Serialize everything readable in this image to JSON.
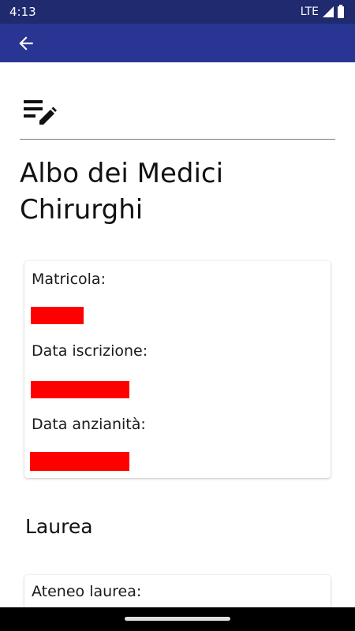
{
  "status_bar": {
    "time": "4:13",
    "network": "LTE"
  },
  "app_bar": {
    "back_icon": "arrow-left-icon",
    "color": "#283593"
  },
  "header": {
    "icon": "edit-list-icon",
    "title": "Albo dei Medici Chirurghi"
  },
  "registration_card": {
    "fields": [
      {
        "label": "Matricola:",
        "value_redacted": true
      },
      {
        "label": "Data iscrizione:",
        "value_redacted": true
      },
      {
        "label": "Data anzianità:",
        "value_redacted": true
      }
    ]
  },
  "degree_section": {
    "title": "Laurea",
    "fields": [
      {
        "label": "Ateneo laurea:"
      }
    ]
  },
  "colors": {
    "status_bar": "#202a6e",
    "redaction": "#ff0000"
  }
}
